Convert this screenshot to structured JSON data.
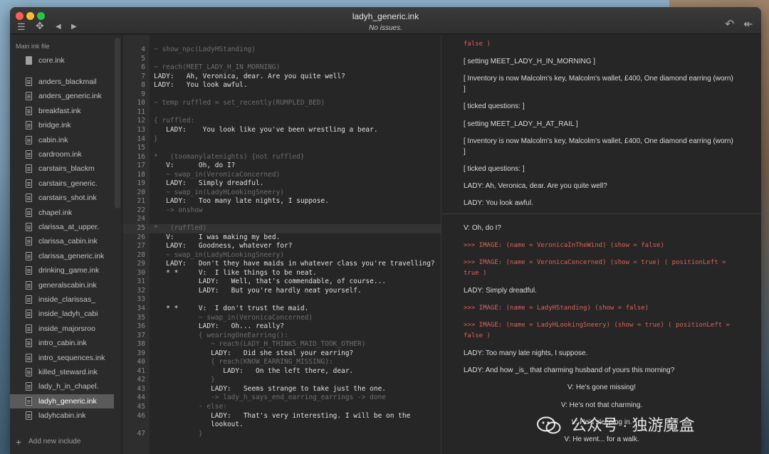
{
  "window": {
    "title": "ladyh_generic.ink",
    "status": "No issues."
  },
  "toolbar": {
    "menu_icon": "☰",
    "nav_icon": "✥",
    "back_icon": "◀",
    "forward_icon": "▶",
    "rewind_icon": "↶",
    "rewind_all_icon": "↞"
  },
  "sidebar": {
    "heading": "Main ink file",
    "main_file": "core.ink",
    "files": [
      "anders_blackmail",
      "anders_generic.ink",
      "breakfast.ink",
      "bridge.ink",
      "cabin.ink",
      "cardroom.ink",
      "carstairs_blackm",
      "carstairs_generic.",
      "carstairs_shot.ink",
      "chapel.ink",
      "clarissa_at_upper.",
      "clarissa_cabin.ink",
      "clarissa_generic.ink",
      "drinking_game.ink",
      "generalscabin.ink",
      "inside_clarissas_",
      "inside_ladyh_cabi",
      "inside_majorsroo",
      "intro_cabin.ink",
      "intro_sequences.ink",
      "killed_steward.ink",
      "lady_h_in_chapel.",
      "ladyh_generic.ink",
      "ladyhcabin.ink"
    ],
    "selected_file": "ladyh_generic.ink",
    "add_include": "Add new include"
  },
  "editor": {
    "lines": [
      {
        "n": "4",
        "t": "~ show_npc(LadyHStanding)",
        "dim": true
      },
      {
        "n": "5",
        "t": "",
        "dim": false
      },
      {
        "n": "6",
        "t": "~ reach(MEET_LADY_H_IN_MORNING)",
        "dim": true
      },
      {
        "n": "7",
        "t": "LADY:   Ah, Veronica, dear. Are you quite well?",
        "dim": false
      },
      {
        "n": "8",
        "t": "LADY:   You look awful.",
        "dim": false
      },
      {
        "n": "9",
        "t": "",
        "dim": false
      },
      {
        "n": "10",
        "t": "~ temp ruffled = set_recently(RUMPLED_BED)",
        "dim": true
      },
      {
        "n": "11",
        "t": "",
        "dim": false
      },
      {
        "n": "12",
        "t": "{ ruffled:",
        "dim": true
      },
      {
        "n": "13",
        "t": "   LADY:    You look like you've been wrestling a bear.",
        "dim": false
      },
      {
        "n": "14",
        "t": "}",
        "dim": true
      },
      {
        "n": "15",
        "t": "",
        "dim": false
      },
      {
        "n": "16",
        "t": "*   (toomanylatenights) {not ruffled}",
        "dim": true
      },
      {
        "n": "17",
        "t": "   V:      Oh, do I?",
        "dim": false
      },
      {
        "n": "18",
        "t": "   ~ swap_in(VeronicaConcerned)",
        "dim": true
      },
      {
        "n": "19",
        "t": "   LADY:   Simply dreadful.",
        "dim": false
      },
      {
        "n": "20",
        "t": "   ~ swap_in(LadyHLookingSneery)",
        "dim": true
      },
      {
        "n": "21",
        "t": "   LADY:   Too many late nights, I suppose.",
        "dim": false
      },
      {
        "n": "22",
        "t": "   -> onshow",
        "dim": true
      },
      {
        "n": "24",
        "t": "",
        "dim": false
      },
      {
        "n": "25",
        "t": "*   (ruffled)",
        "dim": true
      },
      {
        "n": "26",
        "t": "   V:      I was making my bed.",
        "dim": false
      },
      {
        "n": "27",
        "t": "   LADY:   Goodness, whatever for?",
        "dim": false
      },
      {
        "n": "28",
        "t": "   ~ swap_in(LadyHLookingSneery)",
        "dim": true
      },
      {
        "n": "29",
        "t": "   LADY:   Don't they have maids in whatever class you're travelling?",
        "dim": false
      },
      {
        "n": "30",
        "t": "   * *     V:  I like things to be neat.",
        "dim": false
      },
      {
        "n": "31",
        "t": "           LADY:   Well, that's commendable, of course...",
        "dim": false
      },
      {
        "n": "32",
        "t": "           LADY:   But you're hardly neat yourself.",
        "dim": false
      },
      {
        "n": "33",
        "t": "",
        "dim": false
      },
      {
        "n": "34",
        "t": "   * *     V:  I don't trust the maid.",
        "dim": false
      },
      {
        "n": "35",
        "t": "           ~ swap_in(VeronicaConcerned)",
        "dim": true
      },
      {
        "n": "36",
        "t": "           LADY:   Oh... really?",
        "dim": false
      },
      {
        "n": "37",
        "t": "           { wearingOneEarring():",
        "dim": true
      },
      {
        "n": "38",
        "t": "              ~ reach(LADY_H_THINKS_MAID_TOOK_OTHER)",
        "dim": true
      },
      {
        "n": "39",
        "t": "              LADY:   Did she steal your earring?",
        "dim": false
      },
      {
        "n": "40",
        "t": "              { reach(KNOW_EARRING_MISSING):",
        "dim": true
      },
      {
        "n": "41",
        "t": "                 LADY:   On the left there, dear.",
        "dim": false
      },
      {
        "n": "42",
        "t": "              }",
        "dim": true
      },
      {
        "n": "43",
        "t": "              LADY:   Seems strange to take just the one.",
        "dim": false
      },
      {
        "n": "44",
        "t": "              -> lady_h_says_end_earring_earrings -> done",
        "dim": true
      },
      {
        "n": "45",
        "t": "           - else:",
        "dim": true
      },
      {
        "n": "46",
        "t": "              LADY:   That's very interesting. I will be on the",
        "dim": false
      },
      {
        "n": "",
        "t": "              lookout.",
        "dim": false
      },
      {
        "n": "47",
        "t": "           }",
        "dim": true
      }
    ]
  },
  "output": {
    "top": [
      {
        "t": "false )",
        "err": true
      },
      {
        "t": "[ setting MEET_LADY_H_IN_MORNING ]",
        "err": false
      },
      {
        "t": "[ Inventory is now Malcolm's key, Malcolm's wallet, £400, One diamond earring (worn) ]",
        "err": false
      },
      {
        "t": "[ ticked questions: ]",
        "err": false
      },
      {
        "t": "[ setting MEET_LADY_H_AT_RAIL ]",
        "err": false
      },
      {
        "t": "[ Inventory is now Malcolm's key, Malcolm's wallet, £400, One diamond earring (worn) ]",
        "err": false
      },
      {
        "t": "[ ticked questions: ]",
        "err": false
      },
      {
        "t": "LADY: Ah, Veronica, dear. Are you quite well?",
        "err": false
      },
      {
        "t": "LADY: You look awful.",
        "err": false
      }
    ],
    "bottom": [
      {
        "t": "V: Oh, do I?",
        "err": false
      },
      {
        "t": ">>> IMAGE: (name = VeronicaInTheWind) (show = false)",
        "err": true
      },
      {
        "t": ">>> IMAGE: (name = VeronicaConcerned) (show = true) ( positionLeft = true )",
        "err": true
      },
      {
        "t": "LADY: Simply dreadful.",
        "err": false
      },
      {
        "t": ">>> IMAGE: (name = LadyHStanding) (show = false)",
        "err": true
      },
      {
        "t": ">>> IMAGE: (name = LadyHLookingSneery) (show = true) ( positionLeft = false )",
        "err": true
      },
      {
        "t": "LADY: Too many late nights, I suppose.",
        "err": false
      },
      {
        "t": "LADY: And how _is_ that charming husband of yours this morning?",
        "err": false
      }
    ],
    "choices": [
      "V: He's gone missing!",
      "V: He's not that charming.",
      "V: He's sleeping in.",
      "V: He went... for a walk."
    ]
  },
  "watermark": {
    "text": "公众号 · 独游魔盒"
  }
}
